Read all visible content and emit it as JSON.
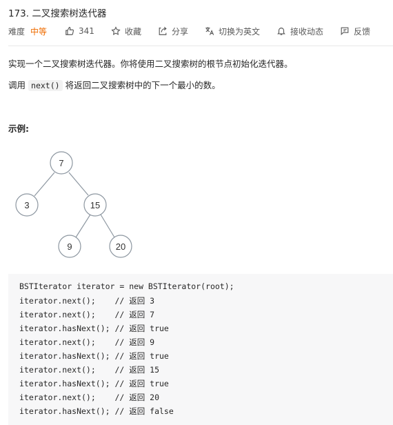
{
  "problem": {
    "title": "173. 二叉搜索树迭代器",
    "difficulty_label": "难度",
    "difficulty": "中等"
  },
  "actions": {
    "like_count": "341",
    "collect": "收藏",
    "share": "分享",
    "switch_lang": "切换为英文",
    "subscribe": "接收动态",
    "feedback": "反馈"
  },
  "description": {
    "line1": "实现一个二叉搜索树迭代器。你将使用二叉搜索树的根节点初始化迭代器。",
    "line2_prefix": "调用",
    "line2_code": "next()",
    "line2_suffix": "将返回二叉搜索树中的下一个最小的数。"
  },
  "example": {
    "heading": "示例:",
    "tree": {
      "nodes": [
        "7",
        "3",
        "15",
        "9",
        "20"
      ]
    },
    "code_lines": [
      "BSTIterator iterator = new BSTIterator(root);",
      "iterator.next();    // 返回 3",
      "iterator.next();    // 返回 7",
      "iterator.hasNext(); // 返回 true",
      "iterator.next();    // 返回 9",
      "iterator.hasNext(); // 返回 true",
      "iterator.next();    // 返回 15",
      "iterator.hasNext(); // 返回 true",
      "iterator.next();    // 返回 20",
      "iterator.hasNext(); // 返回 false"
    ]
  },
  "colors": {
    "difficulty_medium": "#ef6c00",
    "node_stroke": "#8c96a0",
    "code_bg": "#f7f7f8"
  }
}
